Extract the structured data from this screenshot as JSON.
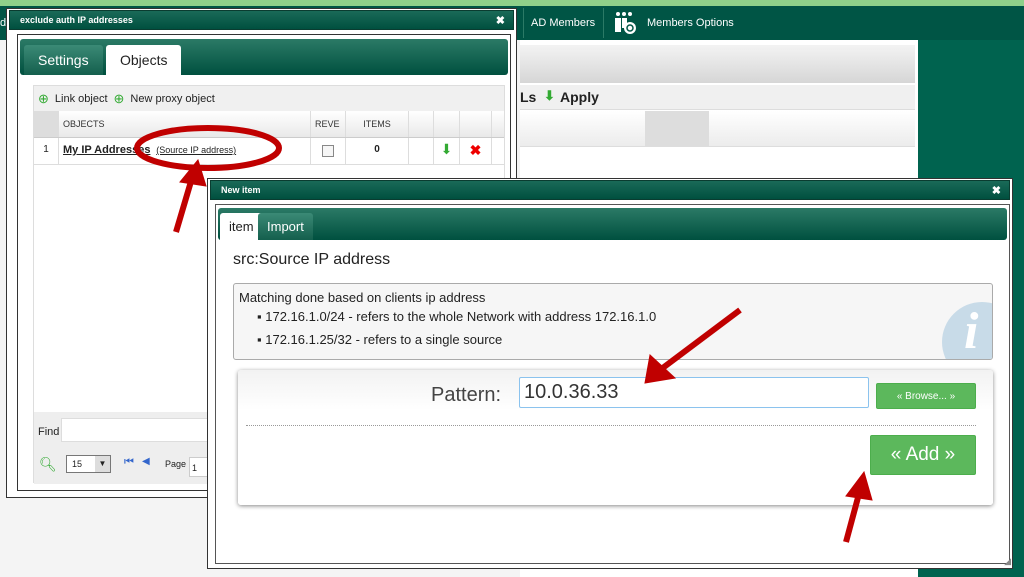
{
  "topnav": {
    "partial_left": "d",
    "items": [
      {
        "label": "AD Members"
      },
      {
        "label": "Members Options",
        "icon": "members-options-icon"
      }
    ]
  },
  "background_panel": {
    "toolbar_partial": "Ls",
    "apply_label": "Apply"
  },
  "objects_dialog": {
    "title": "exclude auth IP addresses",
    "tabs": [
      {
        "label": "Settings",
        "active": false
      },
      {
        "label": "Objects",
        "active": true
      }
    ],
    "toolbar": {
      "link_object": "Link object",
      "new_proxy_object": "New proxy object"
    },
    "columns": [
      "OBJECTS",
      "REVE",
      "ITEMS"
    ],
    "rows": [
      {
        "num": "1",
        "name": "My IP Addresses",
        "type": "(Source IP address)",
        "reverse": false,
        "items": "0"
      }
    ],
    "find_label": "Find",
    "page_size": "15",
    "page_label": "Page",
    "page_value": "1"
  },
  "new_item_dialog": {
    "title": "New item",
    "tabs": [
      {
        "label": "item",
        "active": true
      },
      {
        "label": "Import",
        "active": false
      }
    ],
    "heading": "src:Source IP address",
    "info": {
      "intro": "Matching done based on clients ip address",
      "bullets": [
        "172.16.1.0/24 - refers to the whole Network with address 172.16.1.0",
        "172.16.1.25/32 - refers to a single source"
      ]
    },
    "pattern_label": "Pattern:",
    "pattern_value": "10.0.36.33",
    "browse_label": "« Browse... »",
    "add_label": "« Add »"
  },
  "colors": {
    "header_green": "#005545",
    "button_green": "#5cb85c",
    "annotation_red": "#c00000"
  }
}
